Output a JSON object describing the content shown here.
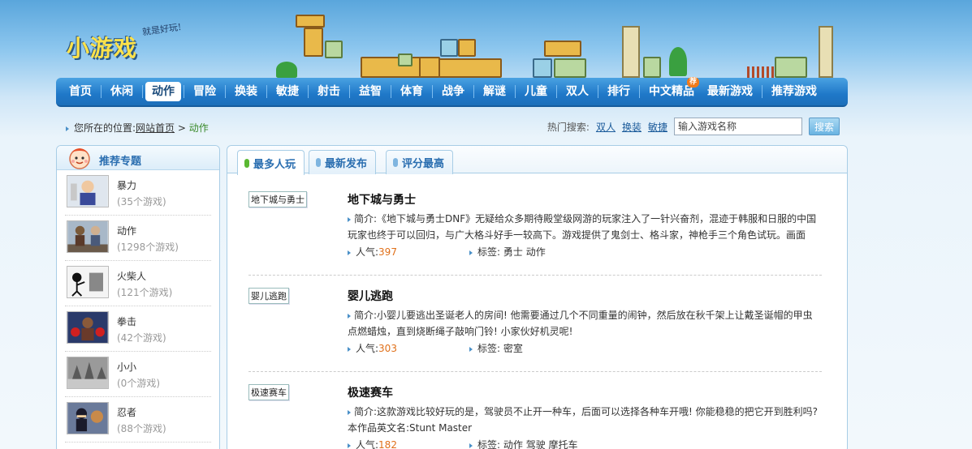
{
  "site": {
    "logo": "小游戏",
    "slogan": "就是好玩!"
  },
  "nav": [
    {
      "label": "首页"
    },
    {
      "label": "休闲"
    },
    {
      "label": "动作",
      "active": true
    },
    {
      "label": "冒险"
    },
    {
      "label": "换装"
    },
    {
      "label": "敏捷"
    },
    {
      "label": "射击"
    },
    {
      "label": "益智"
    },
    {
      "label": "体育"
    },
    {
      "label": "战争"
    },
    {
      "label": "解谜"
    },
    {
      "label": "儿童"
    },
    {
      "label": "双人"
    },
    {
      "label": "排行"
    },
    {
      "label": "中文精品",
      "badge": "荐"
    },
    {
      "label": "最新游戏"
    },
    {
      "label": "推荐游戏"
    }
  ],
  "breadcrumb": {
    "prefix": "您所在的位置:",
    "home": "网站首页",
    "sep": ">",
    "current": "动作"
  },
  "hot_search": {
    "label": "热门搜索:",
    "links": [
      "双人",
      "换装",
      "敏捷"
    ],
    "placeholder": "输入游戏名称",
    "button": "搜索"
  },
  "sidebar": {
    "title": "推荐专题",
    "items": [
      {
        "name": "暴力",
        "count": "(35个游戏)"
      },
      {
        "name": "动作",
        "count": "(1298个游戏)"
      },
      {
        "name": "火柴人",
        "count": "(121个游戏)"
      },
      {
        "name": "拳击",
        "count": "(42个游戏)"
      },
      {
        "name": "小小",
        "count": "(0个游戏)"
      },
      {
        "name": "忍者",
        "count": "(88个游戏)"
      }
    ]
  },
  "tabs": [
    {
      "label": "最多人玩",
      "active": true
    },
    {
      "label": "最新发布"
    },
    {
      "label": "评分最高"
    }
  ],
  "games": [
    {
      "thumb_label": "地下城与勇士",
      "title": "地下城与勇士",
      "desc_label": "简介:",
      "desc": "《地下城与勇士DNF》无疑给众多期待殿堂级网游的玩家注入了一针兴奋剂，混迹于韩服和日服的中国玩家也终于可以回归，与广大格斗好手一较高下。游戏提供了鬼剑士、格斗家，神枪手三个角色试玩。画面",
      "pop_label": "人气:",
      "pop": "397",
      "tag_label": "标签:",
      "tags": "勇士 动作"
    },
    {
      "thumb_label": "婴儿逃跑",
      "title": "婴儿逃跑",
      "desc_label": "简介:",
      "desc": "小婴儿要逃出圣诞老人的房间! 他需要通过几个不同重量的闹钟，然后放在秋千架上让戴圣诞帽的甲虫点燃蜡烛，直到烧断绳子敲响门铃! 小家伙好机灵呢!",
      "pop_label": "人气:",
      "pop": "303",
      "tag_label": "标签:",
      "tags": "密室"
    },
    {
      "thumb_label": "极速赛车",
      "title": "极速赛车",
      "desc_label": "简介:",
      "desc": "这款游戏比较好玩的是，驾驶员不止开一种车，后面可以选择各种车开哦! 你能稳稳的把它开到胜利吗? 本作品英文名:Stunt Master",
      "pop_label": "人气:",
      "pop": "182",
      "tag_label": "标签:",
      "tags": "动作 驾驶 摩托车"
    }
  ]
}
